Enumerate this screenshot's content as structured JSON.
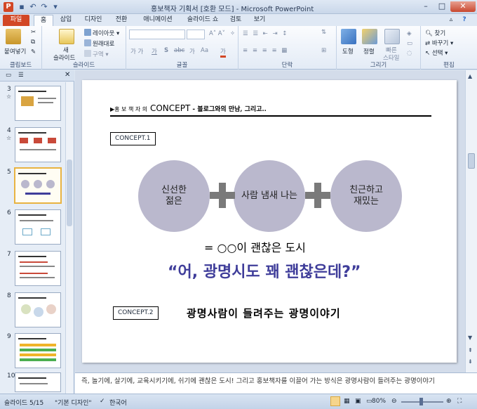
{
  "window": {
    "title": "홍보책자 기획서 [호환 모드] - Microsoft PowerPoint",
    "app_icon": "P"
  },
  "tabs": [
    "파일",
    "홈",
    "삽입",
    "디자인",
    "전환",
    "애니메이션",
    "슬라이드 쇼",
    "검토",
    "보기"
  ],
  "ribbon": {
    "clipboard": {
      "paste": "붙여넣기",
      "label": "클립보드"
    },
    "slides": {
      "new_slide_1": "새",
      "new_slide_2": "슬라이드",
      "layout": "레이아웃",
      "reset": "원래대로",
      "section": "구역",
      "label": "슬라이드"
    },
    "font": {
      "label": "글꼴",
      "gga": "가",
      "shadow": "S",
      "char_spacing": "가",
      "change_case": "Aa",
      "font_color": "가"
    },
    "paragraph": {
      "label": "단락"
    },
    "drawing": {
      "shapes": "도형",
      "arrange": "정렬",
      "quick_styles_1": "빠른",
      "quick_styles_2": "스타일",
      "label": "그리기"
    },
    "editing": {
      "find": "찾기",
      "replace": "바꾸기",
      "select": "선택",
      "label": "편집"
    }
  },
  "thumbnails": [
    {
      "num": "3",
      "star": "☆"
    },
    {
      "num": "4",
      "star": "☆"
    },
    {
      "num": "5",
      "star": ""
    },
    {
      "num": "6",
      "star": ""
    },
    {
      "num": "7",
      "star": ""
    },
    {
      "num": "8",
      "star": ""
    },
    {
      "num": "9",
      "star": ""
    },
    {
      "num": "10",
      "star": ""
    }
  ],
  "slide": {
    "title_prefix": "▶홍 보 책 자 의",
    "title_concept": "CONCEPT",
    "title_suffix": " - 블로그와의 만남, 그리고..",
    "concept1": "CONCEPT.1",
    "circles": [
      "신선한\n젊은",
      "사람 냄새 나는",
      "친근하고\n재밌는"
    ],
    "equation": "= ○○이 괜찮은 도시",
    "quote": "“어, 광명시도 꽤 괜찮은데?”",
    "concept2": "CONCEPT.2",
    "concept2_desc": "광명사람이 들려주는 광명이야기"
  },
  "notes": "즉, 놀기에, 살기에, 교육시키기에, 쉬기에 괜찮은 도시!  그리고 홍보책자를 이끌어 가는 방식은 광명사람이 들려주는 광명이야기",
  "status": {
    "slide_info": "슬라이드 5/15",
    "theme": "\"기본 디자인\"",
    "language": "한국어",
    "zoom": "80%"
  },
  "colors": {
    "file_tab": "#d24726",
    "circle_fill": "#bab8cd",
    "quote_color": "#3f3d9a",
    "selected_thumb": "#e8b341"
  }
}
